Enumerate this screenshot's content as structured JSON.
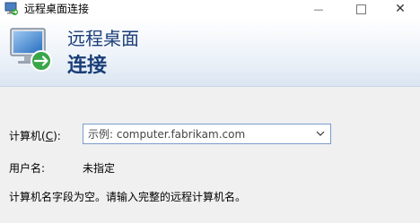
{
  "window": {
    "title": "远程桌面连接",
    "icon": "remote-desktop-icon",
    "min_symbol": "—",
    "close_symbol": "✕"
  },
  "banner": {
    "line1": "远程桌面",
    "line2": "连接",
    "icon": "remote-desktop-monitor-icon"
  },
  "form": {
    "computer_label_prefix": "计算机(",
    "computer_label_key": "C",
    "computer_label_suffix": "):",
    "computer_placeholder": "示例: computer.fabrikam.com",
    "username_label": "用户名:",
    "username_value": "未指定",
    "message": "计算机名字段为空。请输入完整的远程计算机名。"
  },
  "colors": {
    "banner_text": "#1a3e78",
    "input_border": "#7a9ccc"
  }
}
